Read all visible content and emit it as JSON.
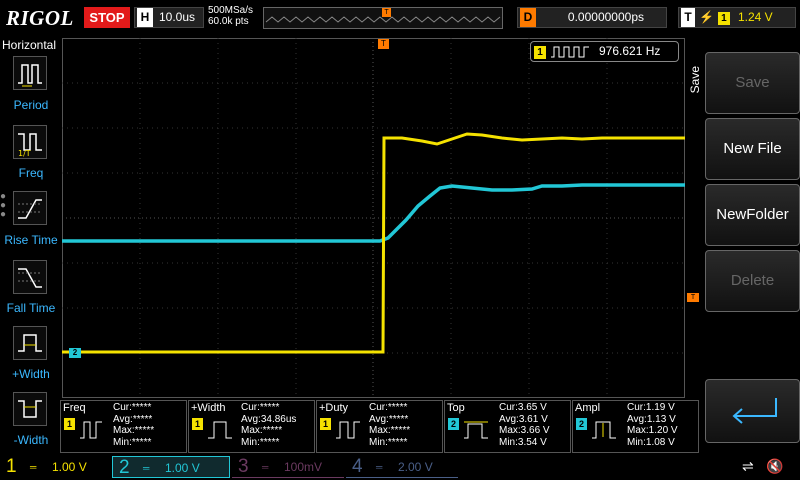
{
  "header": {
    "logo": "RIGOL",
    "run_state": "STOP",
    "horizontal_key": "H",
    "timebase": "10.0us",
    "sample_rate": "500MSa/s",
    "memory_depth": "60.0k pts",
    "delay_key": "D",
    "delay": "0.00000000ps",
    "trigger_key": "T",
    "trigger_source": "1",
    "trigger_level": "1.24 V"
  },
  "left_menu": {
    "title": "Horizontal",
    "items": [
      {
        "label": "Period",
        "icon": "period-icon"
      },
      {
        "label": "Freq",
        "icon": "frequency-icon"
      },
      {
        "label": "Rise Time",
        "icon": "rise-time-icon"
      },
      {
        "label": "Fall Time",
        "icon": "fall-time-icon"
      },
      {
        "label": "+Width",
        "icon": "positive-width-icon"
      },
      {
        "label": "-Width",
        "icon": "negative-width-icon"
      }
    ]
  },
  "screen": {
    "freq_counter_channel": "1",
    "freq_counter_value": "976.621 Hz",
    "ch2_marker": "2",
    "trigger_marker": "T"
  },
  "measurements": [
    {
      "name": "Freq",
      "channel": "1",
      "rows": [
        "Cur:*****",
        "Avg:*****",
        "Max:*****",
        "Min:*****"
      ]
    },
    {
      "name": "+Width",
      "channel": "1",
      "rows": [
        "Cur:*****",
        "Avg:34.86us",
        "Max:*****",
        "Min:*****"
      ]
    },
    {
      "name": "+Duty",
      "channel": "1",
      "rows": [
        "Cur:*****",
        "Avg:*****",
        "Max:*****",
        "Min:*****"
      ]
    },
    {
      "name": "Top",
      "channel": "2",
      "rows": [
        "Cur:3.65 V",
        "Avg:3.61 V",
        "Max:3.66 V",
        "Min:3.54 V"
      ]
    },
    {
      "name": "Ampl",
      "channel": "2",
      "rows": [
        "Cur:1.19 V",
        "Avg:1.13 V",
        "Max:1.20 V",
        "Min:1.08 V"
      ]
    }
  ],
  "right_menu": {
    "title": "Save",
    "buttons": [
      {
        "label": "Save",
        "enabled": false
      },
      {
        "label": "New File",
        "enabled": true
      },
      {
        "label": "NewFolder",
        "enabled": true
      },
      {
        "label": "Delete",
        "enabled": false
      },
      {
        "label": "",
        "enabled": true,
        "icon": "enter-arrow-icon"
      }
    ]
  },
  "channels": [
    {
      "number": "1",
      "scale": "1.00 V",
      "color": "#f5e200",
      "active": true
    },
    {
      "number": "2",
      "scale": "1.00 V",
      "color": "#22c7d6",
      "active": true
    },
    {
      "number": "3",
      "scale": "100mV",
      "color": "#c02a9a",
      "active": false
    },
    {
      "number": "4",
      "scale": "2.00 V",
      "color": "#2f6fd6",
      "active": false
    }
  ],
  "colors": {
    "ch1": "#f5e200",
    "ch2": "#22c7d6",
    "trigger": "#ff7b00",
    "stop": "#e21a1a",
    "menu_label": "#3bb8ff"
  }
}
